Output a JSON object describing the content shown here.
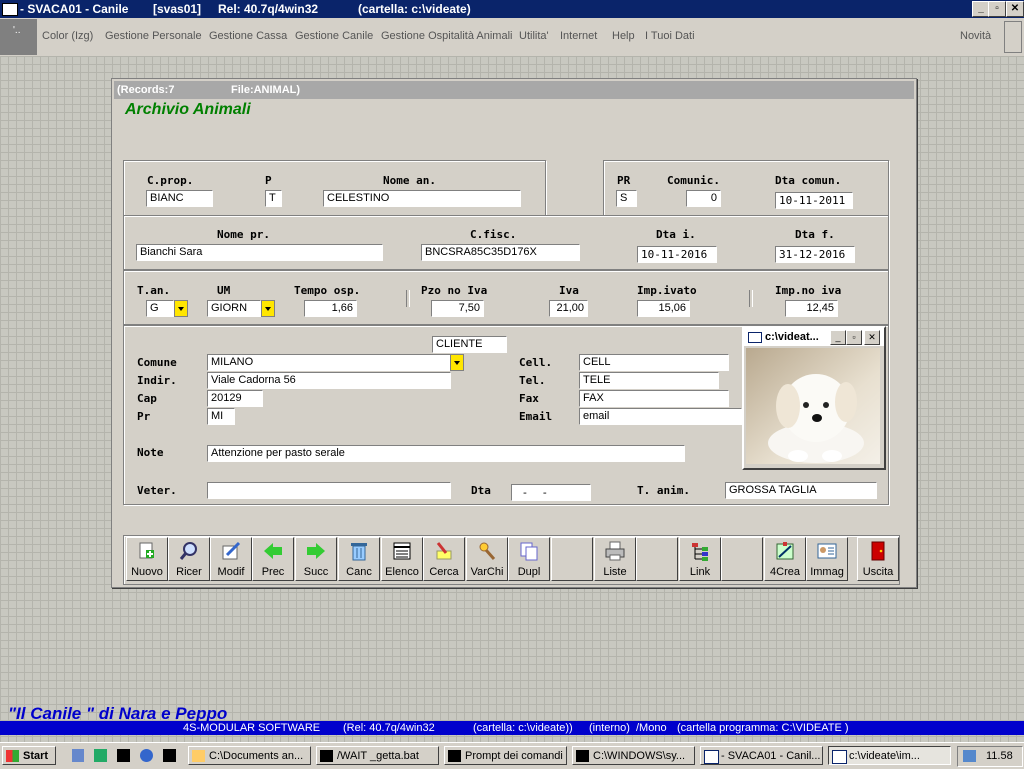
{
  "app": {
    "title": "- SVACA01 - Canile",
    "user": "[svas01]",
    "release": "Rel: 40.7q/4win32",
    "folder": "(cartella: c:\\videate)"
  },
  "menu": [
    "Color (Izg)",
    "Gestione Personale",
    "Gestione Cassa",
    "Gestione Canile",
    "Gestione Ospitalità Animali",
    "Utilita'",
    "Internet",
    "Help",
    "I Tuoi Dati"
  ],
  "menu_right": "Novità",
  "records": {
    "label": "(Records:7",
    "file": "File:ANIMAL)"
  },
  "page_title": "Archivio Animali",
  "labels": {
    "cprop": "C.prop.",
    "p": "P",
    "nome_an": "Nome an.",
    "pr": "PR",
    "comunic": "Comunic.",
    "dta_comun": "Dta comun.",
    "nome_pr": "Nome pr.",
    "cfisc": "C.fisc.",
    "dta_i": "Dta i.",
    "dta_f": "Dta f.",
    "tan": "T.an.",
    "um": "UM",
    "tempo_osp": "Tempo osp.",
    "pzo_no_iva": "Pzo no Iva",
    "iva": "Iva",
    "imp_ivato": "Imp.ivato",
    "imp_no_iva": "Imp.no iva",
    "comune": "Comune",
    "indir": "Indir.",
    "cap": "Cap",
    "prov": "Pr",
    "cell": "Cell.",
    "tel": "Tel.",
    "fax": "Fax",
    "email": "Email",
    "note": "Note",
    "veter": "Veter.",
    "dta": "Dta",
    "t_anim": "T. anim."
  },
  "fields": {
    "cprop": "BIANC",
    "p": "T",
    "nome_an": "CELESTINO",
    "pr": "S",
    "comunic": "0",
    "dta_comun": "10-11-2011",
    "nome_pr": "Bianchi Sara",
    "cfisc": "BNCSRA85C35D176X",
    "dta_i": "10-11-2016",
    "dta_f": "31-12-2016",
    "tan": "G",
    "um": "GIORN",
    "tempo_osp": "1,66",
    "pzo_no_iva": "7,50",
    "iva": "21,00",
    "imp_ivato": "15,06",
    "imp_no_iva": "12,45",
    "cliente": "CLIENTE",
    "comune": "MILANO",
    "indir": "Viale Cadorna 56",
    "cap": "20129",
    "prov": "MI",
    "cell": "CELL",
    "tel": "TELE",
    "fax": "FAX",
    "email": "email",
    "note": "Attenzione per pasto serale",
    "veter": "",
    "dta": " -  - ",
    "t_anim": "GROSSA TAGLIA"
  },
  "picture_window": {
    "title": "c:\\videat..."
  },
  "toolbar": [
    "Nuovo",
    "Ricer",
    "Modif",
    "Prec",
    "Succ",
    "Canc",
    "Elenco",
    "Cerca",
    "VarChi",
    "Dupl",
    "",
    "Liste",
    "",
    "Link",
    "",
    "4Crea",
    "Immag",
    "Uscita"
  ],
  "brand": "\"Il Canile \" di Nara e Peppo",
  "status": {
    "a": "4S-MODULAR SOFTWARE",
    "b": "(Rel: 40.7q/4win32",
    "c": "(cartella: c:\\videate))",
    "d": "(interno)",
    "e": "/Mono",
    "f": "(cartella programma: C:\\VIDEATE )"
  },
  "taskbar": {
    "start": "Start",
    "tasks": [
      "C:\\Documents an...",
      "/WAIT _getta.bat",
      "Prompt dei comandi",
      "C:\\WINDOWS\\sy...",
      "- SVACA01 - Canil...",
      "c:\\videate\\im..."
    ],
    "clock": "11.58"
  }
}
